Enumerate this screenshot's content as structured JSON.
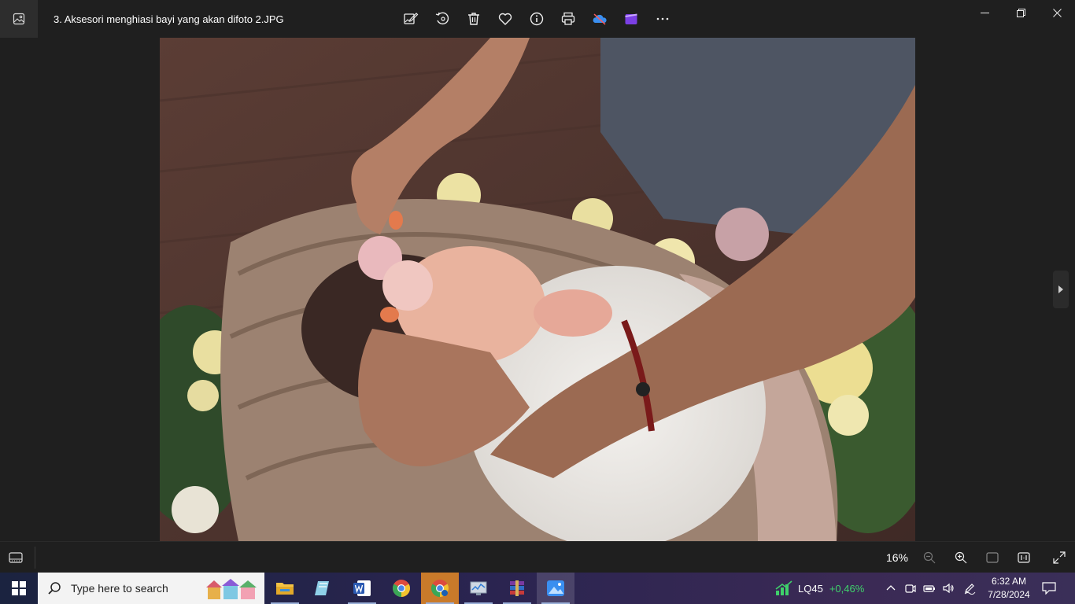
{
  "window": {
    "title": "3. Aksesori menghiasi bayi yang akan difoto 2.JPG"
  },
  "toolbar": {
    "buttons": [
      {
        "name": "edit-image-icon"
      },
      {
        "name": "rotate-icon"
      },
      {
        "name": "delete-icon"
      },
      {
        "name": "favorite-heart-icon"
      },
      {
        "name": "info-icon"
      },
      {
        "name": "print-icon"
      },
      {
        "name": "onedrive-sync-icon"
      },
      {
        "name": "clipchamp-icon"
      },
      {
        "name": "more-options-icon"
      }
    ]
  },
  "photo": {
    "description_icon": "photo-image"
  },
  "statusbar": {
    "zoom": "16%"
  },
  "taskbar": {
    "search_placeholder": "Type here to search",
    "stock_name": "LQ45",
    "stock_change": "+0,46%",
    "time": "6:32 AM",
    "date": "7/28/2024"
  },
  "colors": {
    "background": "#1f1f1f",
    "accent_green": "#3fd16b",
    "onedrive_blue": "#3a8ff0"
  }
}
